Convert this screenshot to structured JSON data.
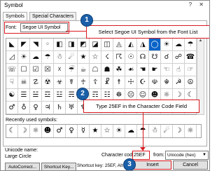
{
  "window": {
    "title": "Symbol",
    "controls": "?  ✕"
  },
  "tabs": [
    {
      "label": "Symbols"
    },
    {
      "label": "Special Characters"
    }
  ],
  "font": {
    "label": "Font:",
    "value": "Segoe UI Symbol"
  },
  "callouts": {
    "step1": {
      "number": "1",
      "text": "Select Segoe UI Symbol from the Font List"
    },
    "step2": {
      "number": "2",
      "text": "Type 25EF in the Character Code Field"
    },
    "step3": {
      "number": "3"
    }
  },
  "symbol_grid": {
    "rows": [
      [
        "◣",
        "◤",
        "◥",
        "◦",
        "◧",
        "◨",
        "◩",
        "◪",
        "◫",
        "◬",
        "◭",
        "◮",
        "◯",
        "☀",
        "☁",
        "☂"
      ],
      [
        "◿",
        "☀",
        "☁",
        "☂",
        "☃",
        "☄",
        "★",
        "☆",
        "☇",
        "☈",
        "☉",
        "☊",
        "☋",
        "☌",
        "☍",
        "☎"
      ],
      [
        "☏",
        "☐",
        "☑",
        "☒",
        "☓",
        "☔",
        "☕",
        "☖",
        "☗",
        "☘",
        "☙",
        "☚",
        "☛",
        "☜",
        "☝",
        "☞"
      ],
      [
        "☟",
        "☠",
        "☡",
        "☢",
        "☣",
        "☤",
        "☥",
        "☦",
        "☧",
        "☨",
        "☩",
        "☪",
        "☫",
        "☬",
        "☭",
        "☮"
      ],
      [
        "☯",
        "☰",
        "☱",
        "☲",
        "☳",
        "☴",
        "☵",
        "☶",
        "☷",
        "☸",
        "☹",
        "☺",
        "☻",
        "☼",
        "☽",
        "☾"
      ],
      [
        "♂",
        "♁",
        "♀",
        "♃",
        "♄",
        "♅",
        "♆",
        "♇",
        "♈",
        "♉",
        "♊",
        "♋",
        "♌",
        "♍",
        "♎",
        "♏"
      ]
    ],
    "selected_row": 0,
    "selected_col": 12
  },
  "recently_used": {
    "label": "Recently used symbols:",
    "symbols": [
      "☾",
      "☽",
      "☼",
      "☻",
      "♂",
      "♀",
      "☿",
      "★",
      "☆",
      "☀",
      "☁",
      "☂",
      "☃",
      "☄",
      "☽",
      "☼"
    ]
  },
  "unicode_name": {
    "label": "Unicode name:",
    "value": "Large Circle"
  },
  "character_code": {
    "label": "Character code:",
    "value": "25EF"
  },
  "from": {
    "label": "from:",
    "value": "Unicode (hex)"
  },
  "buttons": {
    "autocorrect": "AutoCorrect...",
    "shortcut_key": "Shortcut Key...",
    "insert": "Insert",
    "cancel": "Cancel"
  },
  "shortcut_key_text": "Shortcut key: 25EF, Alt+X",
  "colors": {
    "callout_border": "#d9191f",
    "badge": "#1a5fa8",
    "selected_cell": "#0a64c8"
  }
}
